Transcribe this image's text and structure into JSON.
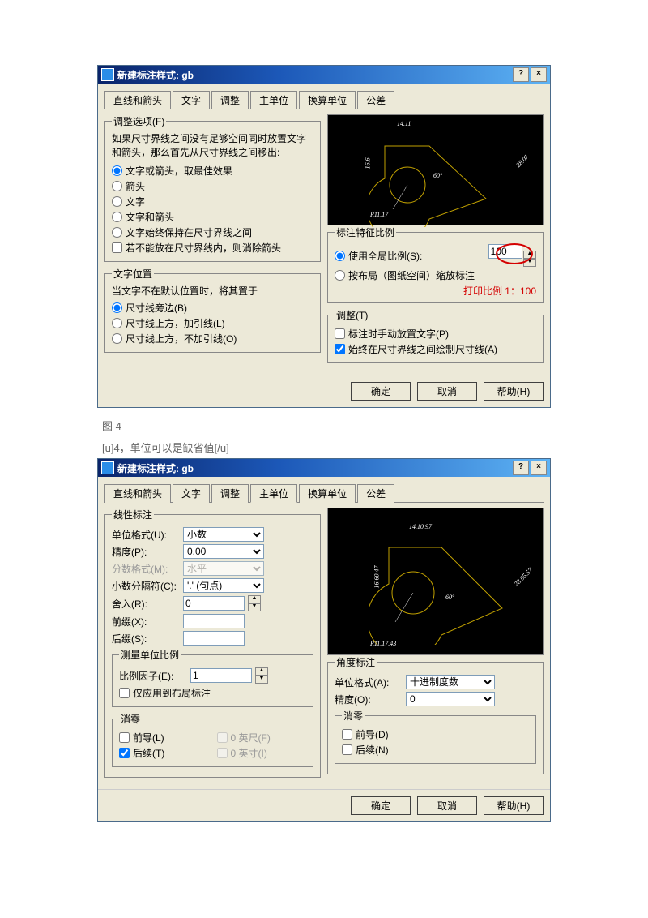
{
  "dialog1": {
    "title": "新建标注样式: gb",
    "tabs": [
      "直线和箭头",
      "文字",
      "调整",
      "主单位",
      "换算单位",
      "公差"
    ],
    "active_tab": "调整",
    "fit_options": {
      "legend": "调整选项(F)",
      "intro": "如果尺寸界线之间没有足够空间同时放置文字和箭头，那么首先从尺寸界线之间移出:",
      "radios": [
        "文字或箭头，取最佳效果",
        "箭头",
        "文字",
        "文字和箭头",
        "文字始终保持在尺寸界线之间"
      ],
      "checkbox": "若不能放在尺寸界线内，则消除箭头"
    },
    "text_placement": {
      "legend": "文字位置",
      "intro": "当文字不在默认位置时，将其置于",
      "radios": [
        "尺寸线旁边(B)",
        "尺寸线上方，加引线(L)",
        "尺寸线上方，不加引线(O)"
      ]
    },
    "scale": {
      "legend": "标注特征比例",
      "radio1": "使用全局比例(S):",
      "value": "100",
      "radio2": "按布局（图纸空间）缩放标注",
      "annotation": "打印比例 1：100"
    },
    "fine_tune": {
      "legend": "调整(T)",
      "c1": "标注时手动放置文字(P)",
      "c2": "始终在尺寸界线之间绘制尺寸线(A)"
    },
    "footer": {
      "ok": "确定",
      "cancel": "取消",
      "help": "帮助(H)"
    },
    "preview_dims": {
      "top": "14.11",
      "right": "28.07",
      "left": "16.6",
      "angle": "60°",
      "radius": "R11.17"
    }
  },
  "captions": {
    "fig": "图 4",
    "note": "[u]4，单位可以是缺省值[/u]"
  },
  "dialog2": {
    "title": "新建标注样式: gb",
    "tabs": [
      "直线和箭头",
      "文字",
      "调整",
      "主单位",
      "换算单位",
      "公差"
    ],
    "active_tab": "主单位",
    "linear": {
      "legend": "线性标注",
      "unit_format_label": "单位格式(U):",
      "unit_format": "小数",
      "precision_label": "精度(P):",
      "precision": "0.00",
      "fraction_label": "分数格式(M):",
      "fraction": "水平",
      "decimal_sep_label": "小数分隔符(C):",
      "decimal_sep": "'.' (句点)",
      "round_label": "舍入(R):",
      "round": "0",
      "prefix_label": "前缀(X):",
      "prefix": "",
      "suffix_label": "后缀(S):",
      "suffix": ""
    },
    "measure_scale": {
      "legend": "测量单位比例",
      "factor_label": "比例因子(E):",
      "factor": "1",
      "chk": "仅应用到布局标注"
    },
    "zero_linear": {
      "legend": "消零",
      "leading": "前导(L)",
      "trailing": "后续(T)",
      "feet": "0 英尺(F)",
      "inches": "0 英寸(I)"
    },
    "angular": {
      "legend": "角度标注",
      "unit_format_label": "单位格式(A):",
      "unit_format": "十进制度数",
      "precision_label": "精度(O):",
      "precision": "0"
    },
    "zero_angular": {
      "legend": "消零",
      "leading": "前导(D)",
      "trailing": "后续(N)"
    },
    "footer": {
      "ok": "确定",
      "cancel": "取消",
      "help": "帮助(H)"
    },
    "preview_dims": {
      "top": "14.10.97",
      "right": "28.05.57",
      "left": "16.60.47",
      "angle": "60°",
      "radius": "R11.17.43"
    }
  }
}
